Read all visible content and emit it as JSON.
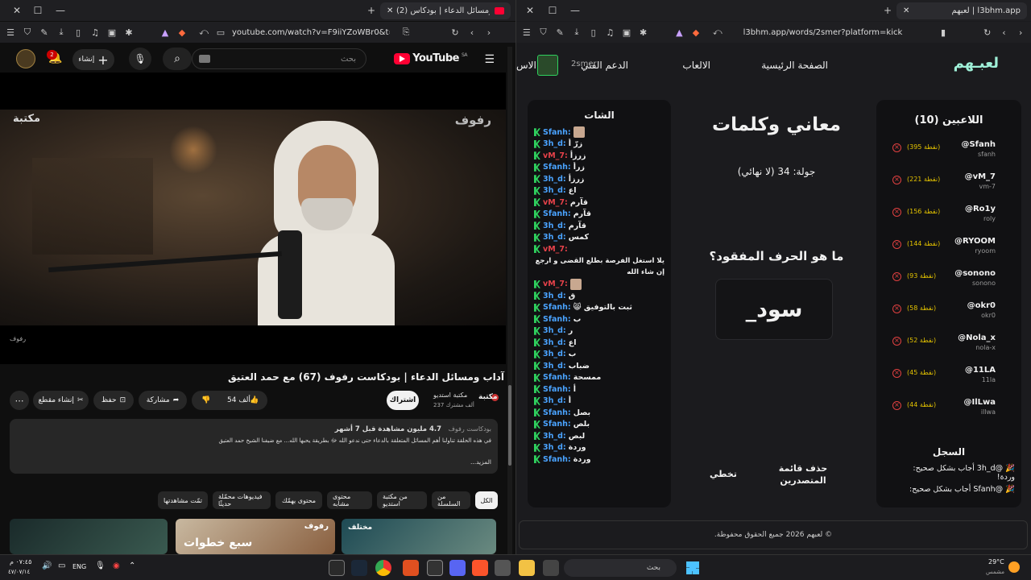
{
  "left": {
    "tab_title": "(2) آداب ومسائل الدعاء | بودكاس",
    "url": "youtube.com/watch?v=F9iiYZoWBr0&t=3...",
    "youtube": {
      "logo": "YouTube",
      "logo_sup": "SA",
      "search_placeholder": "بحث",
      "create_label": "إنشاء",
      "notifications_count": "2",
      "video": {
        "title": "آداب ومسائل الدعاء | بودكاست رفوف (67) مع حمد العتيق",
        "watermark_right": "رفوف",
        "watermark_left": "مكتبة",
        "bottom_caption": "رفوف",
        "channel": "مكتبة استديو",
        "subscribers": "237 ألف مشترك",
        "subscribe_label": "اشتراك",
        "likes": "54 ألف",
        "share_label": "مشاركة",
        "save_label": "حفظ",
        "clip_label": "إنشاء مقطع",
        "stats": "4.7 مليون مشاهدة  قبل 7 أشهر",
        "playlist_tag": "بودكاست رفوف",
        "description": "في هذه الحلقة تناولنا أهم المسائل المتعلقة بالدعاء حتى ندعو الله ﷻ بطريقة يحبها الله... مع ضيفنا الشيخ حمد العتيق",
        "more_label": "...المزيد"
      },
      "chips": [
        "الكل",
        "من السلسلة",
        "من مكتبة استديو",
        "محتوى مشابه",
        "محتوى يهمّك",
        "فيديوهات محمّلة حديثًا",
        "تمّت مشاهدتها"
      ],
      "thumb_labels": [
        "مختلف",
        "رفوف",
        "سبع خطوات"
      ]
    }
  },
  "right": {
    "tab_title": "لعبهم | l3bhm.app",
    "url": "l3bhm.app/words/2smer?platform=kick",
    "site": {
      "logo": "لعبـهم",
      "nav": [
        "الصفحة الرئيسية",
        "الالعاب",
        "الدعم الفني"
      ],
      "username": "2smer",
      "extra_nav": "الاس",
      "players_title": "اللاعبين (10)",
      "players": [
        {
          "name": "@Sfanh",
          "user": "sfanh",
          "score": "(395 نقطة)"
        },
        {
          "name": "@vM_7",
          "user": "vm-7",
          "score": "(221 نقطة)"
        },
        {
          "name": "@Ro1y",
          "user": "roly",
          "score": "(156 نقطة)"
        },
        {
          "name": "@RYOOM",
          "user": "ryoom",
          "score": "(144 نقطة)"
        },
        {
          "name": "@sonono",
          "user": "sonono",
          "score": "(93 نقطة)"
        },
        {
          "name": "@okr0",
          "user": "okr0",
          "score": "(58 نقطة)"
        },
        {
          "name": "@Nola_x",
          "user": "nola-x",
          "score": "(52 نقطة)"
        },
        {
          "name": "@11LA",
          "user": "11la",
          "score": "(45 نقطة)"
        },
        {
          "name": "@IlLwa",
          "user": "illwa",
          "score": "(44 نقطة)"
        }
      ],
      "log_title": "السجل",
      "log": [
        "🎉 @3h_d أجاب بشكل صحيح: وردة!",
        "🎉 @Sfanh أجاب بشكل صحيح:"
      ],
      "game_title": "معاني وكلمات",
      "round": "جولة: 34 (لا نهائي)",
      "question": "ما هو الحرف المفقود؟",
      "word": "سود_",
      "skip_label": "تخطي",
      "clear_label": "حذف قائمة المتصدرين",
      "chat_title": "الشات",
      "chat": [
        {
          "u": "Sfanh",
          "m": "",
          "c": "#4aa3ff",
          "sticker": true
        },
        {
          "u": "3h_d",
          "m": "زرّ أ",
          "c": "#4aa3ff"
        },
        {
          "u": "vM_7",
          "m": "زرزأ",
          "c": "#e8424a"
        },
        {
          "u": "Sfanh",
          "m": "زرأ",
          "c": "#4aa3ff"
        },
        {
          "u": "3h_d",
          "m": "زرزأ",
          "c": "#4aa3ff"
        },
        {
          "u": "3h_d",
          "m": "اع",
          "c": "#4aa3ff"
        },
        {
          "u": "vM_7",
          "m": "قآرم",
          "c": "#e8424a"
        },
        {
          "u": "Sfanh",
          "m": "قآرم",
          "c": "#4aa3ff"
        },
        {
          "u": "3h_d",
          "m": "قآرم",
          "c": "#4aa3ff"
        },
        {
          "u": "3h_d",
          "m": "كمس",
          "c": "#4aa3ff"
        },
        {
          "u": "vM_7",
          "m": "",
          "c": "#e8424a"
        },
        {
          "u": "",
          "m": "يلا استغل الفرصة بطلع القضى و ارجع",
          "c": "#4aa3ff"
        },
        {
          "u": "",
          "m": "إن شاء الله",
          "c": "#4aa3ff"
        },
        {
          "u": "vM_7",
          "m": "",
          "c": "#e8424a",
          "sticker": true
        },
        {
          "u": "3h_d",
          "m": "ق",
          "c": "#4aa3ff"
        },
        {
          "u": "Sfanh",
          "m": "ثبت بالتوفيق 😸",
          "c": "#4aa3ff"
        },
        {
          "u": "Sfanh",
          "m": "ب",
          "c": "#4aa3ff"
        },
        {
          "u": "3h_d",
          "m": "ر",
          "c": "#4aa3ff"
        },
        {
          "u": "3h_d",
          "m": "اع",
          "c": "#4aa3ff"
        },
        {
          "u": "3h_d",
          "m": "ب",
          "c": "#4aa3ff"
        },
        {
          "u": "3h_d",
          "m": "ضباب",
          "c": "#4aa3ff"
        },
        {
          "u": "Sfanh",
          "m": "ممسحة",
          "c": "#4aa3ff"
        },
        {
          "u": "Sfanh",
          "m": "أ",
          "c": "#4aa3ff"
        },
        {
          "u": "3h_d",
          "m": "أ",
          "c": "#4aa3ff"
        },
        {
          "u": "Sfanh",
          "m": "بصل",
          "c": "#4aa3ff"
        },
        {
          "u": "Sfanh",
          "m": "بلص",
          "c": "#4aa3ff"
        },
        {
          "u": "3h_d",
          "m": "لبص",
          "c": "#4aa3ff"
        },
        {
          "u": "3h_d",
          "m": "وردة",
          "c": "#4aa3ff"
        },
        {
          "u": "Sfanh",
          "m": "وردة",
          "c": "#4aa3ff"
        }
      ],
      "footer": "© لعبهم 2026 جميع الحقوق محفوظة."
    }
  },
  "taskbar": {
    "search": "بحث",
    "weather_temp": "29°C",
    "weather_desc": "مشمس",
    "lang": "ENG",
    "time": "٠٧:٤٥ م",
    "date": "٤٧/٠٧/١٤"
  },
  "colors": {
    "accent_red": "#ff0033",
    "kick_green": "#2fd15e",
    "score_yellow": "#e3c200"
  }
}
